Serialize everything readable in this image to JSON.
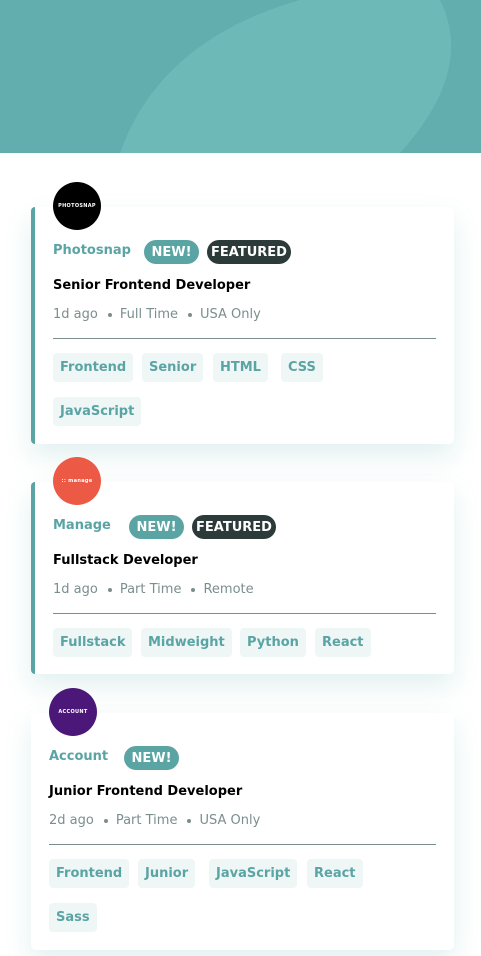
{
  "colors": {
    "header_bg": "#6cb9b8",
    "accent": "#5ba4a4",
    "featured_badge": "#2c3a3a",
    "tag_bg": "#eef6f6",
    "meta_text": "#7b8e8e"
  },
  "jobs": [
    {
      "company": "Photosnap",
      "logo_text": "PHOTOSNAP",
      "logo_color": "#000000",
      "badges": {
        "new": "NEW!",
        "featured": "FEATURED"
      },
      "position": "Senior Frontend Developer",
      "posted": "1d ago",
      "contract": "Full Time",
      "location": "USA Only",
      "tags": [
        "Frontend",
        "Senior",
        "HTML",
        "CSS",
        "JavaScript"
      ]
    },
    {
      "company": "Manage",
      "logo_text": ":: manage",
      "logo_color": "#ec5a45",
      "badges": {
        "new": "NEW!",
        "featured": "FEATURED"
      },
      "position": "Fullstack Developer",
      "posted": "1d ago",
      "contract": "Part Time",
      "location": "Remote",
      "tags": [
        "Fullstack",
        "Midweight",
        "Python",
        "React"
      ]
    },
    {
      "company": "Account",
      "logo_text": "ACCOUNT",
      "logo_color": "#4b1778",
      "badges": {
        "new": "NEW!"
      },
      "position": "Junior Frontend Developer",
      "posted": "2d ago",
      "contract": "Part Time",
      "location": "USA Only",
      "tags": [
        "Frontend",
        "Junior",
        "JavaScript",
        "React",
        "Sass"
      ]
    }
  ]
}
